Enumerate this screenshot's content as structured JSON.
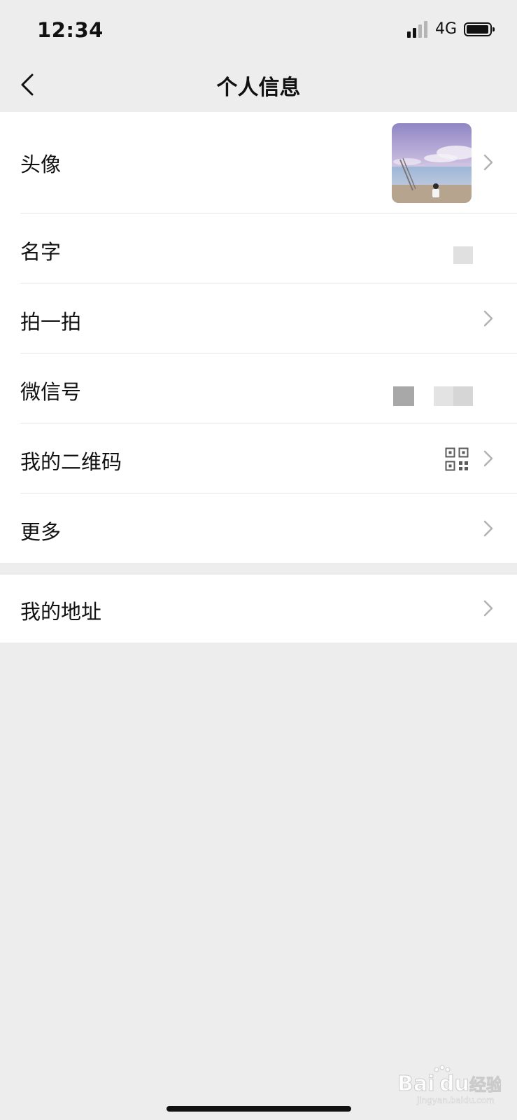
{
  "status_bar": {
    "time": "12:34",
    "network": "4G",
    "icons": [
      "signal-icon",
      "battery-icon"
    ]
  },
  "nav": {
    "title": "个人信息",
    "back_icon": "chevron-left-icon"
  },
  "profile_rows": [
    {
      "label": "头像",
      "value_type": "avatar-image",
      "has_chevron": true
    },
    {
      "label": "名字",
      "value_type": "redacted",
      "has_chevron": false
    },
    {
      "label": "拍一拍",
      "value_type": "none",
      "has_chevron": true
    },
    {
      "label": "微信号",
      "value_type": "redacted",
      "has_chevron": false
    },
    {
      "label": "我的二维码",
      "value_type": "qr-code-icon",
      "has_chevron": true
    },
    {
      "label": "更多",
      "value_type": "none",
      "has_chevron": true
    }
  ],
  "address_rows": [
    {
      "label": "我的地址",
      "value_type": "none",
      "has_chevron": true
    }
  ],
  "watermark": {
    "brand": "Bai",
    "brand_suffix": "du",
    "product": "经验",
    "url": "jingyan.baidu.com"
  },
  "colors": {
    "background": "#ededed",
    "card": "#ffffff",
    "text": "#111111",
    "chevron": "#b2b2b2",
    "divider": "#e5e5e5"
  }
}
